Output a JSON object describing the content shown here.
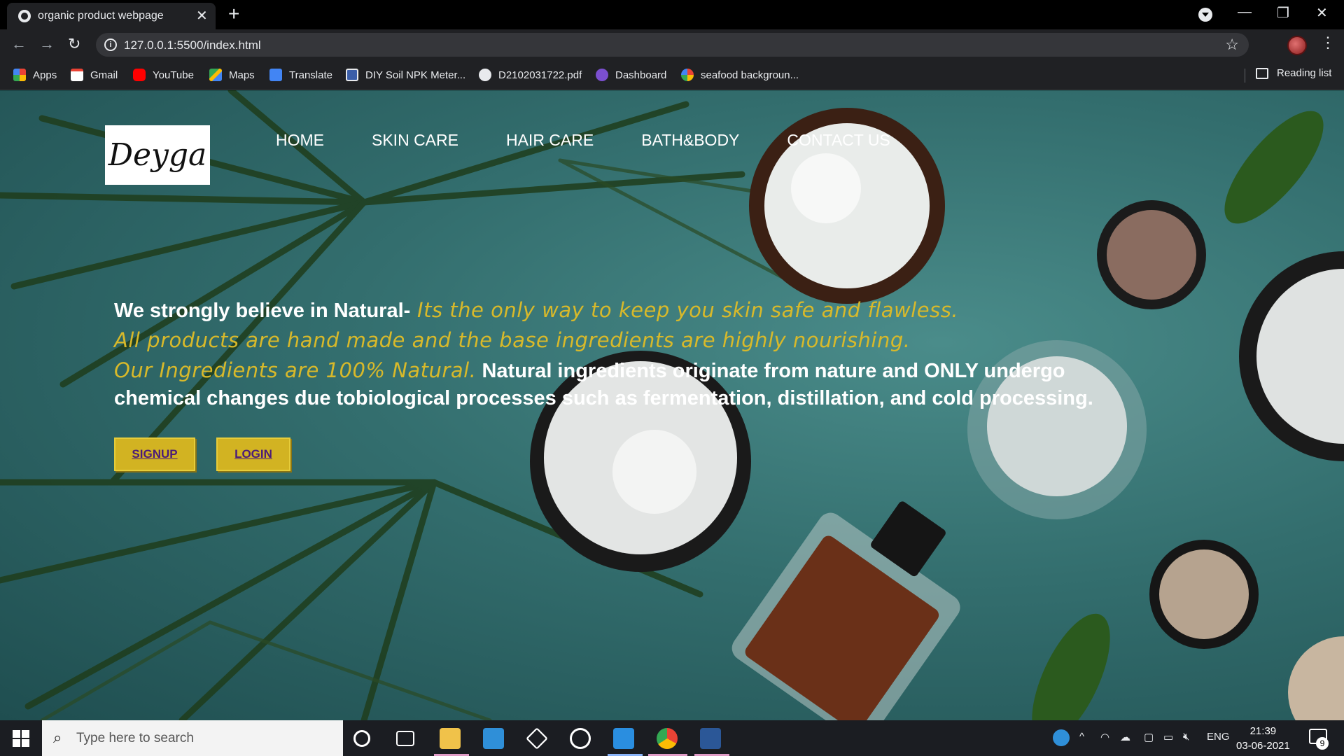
{
  "browser": {
    "tab_title": "organic product webpage",
    "new_tab": "+",
    "url": "127.0.0.1:5500/index.html",
    "controls": {
      "minimize": "—",
      "restore": "❐",
      "close": "✕"
    },
    "nav": {
      "back": "←",
      "forward": "→",
      "reload": "↻"
    },
    "bookmarks": [
      {
        "label": "Apps",
        "icon": "apps-grid-icon",
        "color": "#ea4335"
      },
      {
        "label": "Gmail",
        "icon": "gmail-icon",
        "color": "#ea4335"
      },
      {
        "label": "YouTube",
        "icon": "youtube-icon",
        "color": "#ff0000"
      },
      {
        "label": "Maps",
        "icon": "maps-icon",
        "color": "#34a853"
      },
      {
        "label": "Translate",
        "icon": "translate-icon",
        "color": "#4285f4"
      },
      {
        "label": "DIY Soil NPK Meter...",
        "icon": "page-icon",
        "color": "#3b5ea8"
      },
      {
        "label": "D2102031722.pdf",
        "icon": "globe-icon",
        "color": "#e8eaed"
      },
      {
        "label": "Dashboard",
        "icon": "dashboard-icon",
        "color": "#7b4fd0"
      },
      {
        "label": "seafood backgroun...",
        "icon": "google-icon",
        "color": "#ffffff"
      }
    ],
    "reading_list": "Reading list"
  },
  "page": {
    "logo_text": "Deyga",
    "nav": [
      "HOME",
      "SKIN CARE",
      "HAIR CARE",
      "BATH&BODY",
      "CONTACT US"
    ],
    "hero": {
      "line1_bold": "We strongly believe in Natural-",
      "line1_accent": " Its the only way to keep you skin safe and flawless.",
      "line2_accent": "All products are hand made and the base ingredients are highly nourishing.",
      "line3_accent": "Our Ingredients are 100% Natural.",
      "line3_bold": " Natural ingredients originate from nature and ONLY undergo",
      "line4_bold": "chemical changes due tobiological processes such as fermentation, distillation, and cold processing."
    },
    "buttons": {
      "signup": "SIGNUP",
      "login": "LOGIN"
    },
    "colors": {
      "accent": "#d8b92a",
      "button_bg": "#d2b322",
      "button_text": "#4a1a7a",
      "background": "#336e6e"
    }
  },
  "taskbar": {
    "search_placeholder": "Type here to search",
    "language": "ENG",
    "time": "21:39",
    "date": "03-06-2021",
    "notification_count": "9"
  }
}
